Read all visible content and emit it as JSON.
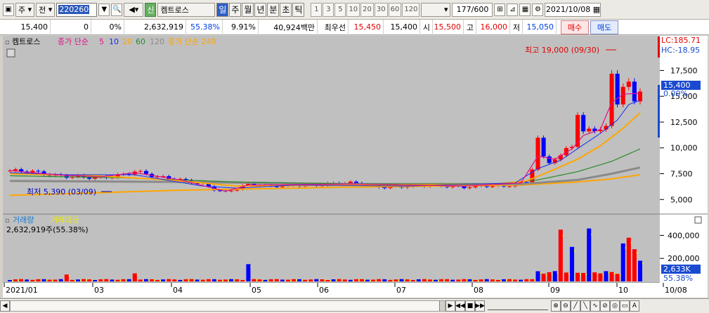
{
  "toolbar": {
    "market": "주",
    "period_selector": "전",
    "stock_code": "220260",
    "stock_name": "켐트로스",
    "credit_badge": "신",
    "periods": [
      "일",
      "주",
      "월",
      "년",
      "분",
      "초",
      "틱"
    ],
    "active_period": "일",
    "intervals": [
      "1",
      "3",
      "5",
      "10",
      "20",
      "30",
      "60",
      "120"
    ],
    "page_count": "177",
    "page_total": "/600",
    "date": "2021/10/08"
  },
  "quote": {
    "price": "15,400",
    "change": "0",
    "change_pct": "0%",
    "volume": "2,632,919",
    "volume_ratio": "55.38%",
    "turnover": "9.91%",
    "trade_value": "40,924백만",
    "best_bid_label": "최우선",
    "best_ask": "15,450",
    "best_bid": "15,400",
    "open_label": "시",
    "open": "15,500",
    "high_label": "고",
    "high": "16,000",
    "low_label": "저",
    "low": "15,050",
    "buy_label": "매수",
    "sell_label": "매도"
  },
  "price_panel": {
    "name": "켐트로스",
    "ma_label_1": "종가 단순",
    "ma_periods": [
      "5",
      "10",
      "20",
      "60",
      "120"
    ],
    "ma_label_2": "종가 단순 240",
    "colors": {
      "ma5": "#e0108a",
      "ma10": "#1a2cf0",
      "ma20": "#ffa500",
      "ma60": "#2a8a2a",
      "ma120": "#8a8a8a",
      "ma240": "#ffa500",
      "up": "#ff0000",
      "down": "#0000ff"
    },
    "high_note": "최고 19,000 (09/30)",
    "low_note": "최저 5,390 (03/09)",
    "lc": "LC:185.71",
    "hc": "HC:-18.95",
    "current_tag": "15,400",
    "current_pct": "0.00%",
    "y_ticks": [
      "17,500",
      "15,000",
      "12,500",
      "10,000",
      "7,500",
      "5,000"
    ]
  },
  "volume_panel": {
    "title_1": "거래량",
    "title_2": "거래대금",
    "value": "2,632,919주(55.38%)",
    "y_ticks": [
      "400,000",
      "200,000"
    ],
    "current_tag": "2,633K",
    "current_pct": "55.38%"
  },
  "x_axis": [
    "2021/01",
    "03",
    "04",
    "05",
    "06",
    "07",
    "08",
    "09",
    "10",
    "10/08"
  ],
  "chart_data": {
    "type": "candlestick",
    "ylim": [
      4000,
      19500
    ],
    "price_path": [
      [
        0,
        7800
      ],
      [
        4,
        7700
      ],
      [
        8,
        7300
      ],
      [
        12,
        7200
      ],
      [
        16,
        7100
      ],
      [
        20,
        7400
      ],
      [
        22,
        7750
      ],
      [
        26,
        7200
      ],
      [
        30,
        6900
      ],
      [
        34,
        6500
      ],
      [
        36,
        6000
      ],
      [
        38,
        5700
      ],
      [
        40,
        6100
      ],
      [
        42,
        6500
      ],
      [
        46,
        6300
      ],
      [
        50,
        6400
      ],
      [
        54,
        6400
      ],
      [
        58,
        6600
      ],
      [
        62,
        6600
      ],
      [
        64,
        6300
      ],
      [
        66,
        6200
      ],
      [
        70,
        6300
      ],
      [
        72,
        6400
      ],
      [
        76,
        6350
      ],
      [
        80,
        6200
      ],
      [
        84,
        6350
      ],
      [
        87,
        6300
      ],
      [
        89,
        6500
      ],
      [
        91,
        6700
      ],
      [
        92,
        8000
      ],
      [
        93,
        10800
      ],
      [
        94,
        9100
      ],
      [
        95,
        8700
      ],
      [
        96,
        8900
      ],
      [
        97,
        9100
      ],
      [
        98,
        10000
      ],
      [
        99,
        10300
      ],
      [
        100,
        13100
      ],
      [
        101,
        11400
      ],
      [
        102,
        12000
      ],
      [
        103,
        11800
      ],
      [
        104,
        11600
      ],
      [
        105,
        12000
      ],
      [
        106,
        17500
      ],
      [
        107,
        14300
      ],
      [
        108,
        15600
      ],
      [
        109,
        16400
      ],
      [
        110,
        14800
      ],
      [
        111,
        15400
      ]
    ],
    "ma5_path": [
      [
        0,
        7800
      ],
      [
        8,
        7400
      ],
      [
        16,
        7200
      ],
      [
        22,
        7600
      ],
      [
        30,
        6900
      ],
      [
        38,
        5800
      ],
      [
        42,
        6400
      ],
      [
        60,
        6500
      ],
      [
        80,
        6300
      ],
      [
        90,
        6600
      ],
      [
        93,
        9200
      ],
      [
        96,
        8900
      ],
      [
        99,
        9900
      ],
      [
        101,
        11200
      ],
      [
        104,
        11800
      ],
      [
        106,
        14400
      ],
      [
        108,
        15200
      ],
      [
        111,
        15300
      ]
    ],
    "ma10_path": [
      [
        0,
        7600
      ],
      [
        10,
        7400
      ],
      [
        22,
        7400
      ],
      [
        34,
        6300
      ],
      [
        40,
        6100
      ],
      [
        50,
        6400
      ],
      [
        70,
        6300
      ],
      [
        89,
        6600
      ],
      [
        93,
        8000
      ],
      [
        97,
        8800
      ],
      [
        101,
        10300
      ],
      [
        104,
        11400
      ],
      [
        107,
        12700
      ],
      [
        109,
        14200
      ],
      [
        111,
        14600
      ]
    ],
    "ma20_path": [
      [
        0,
        7500
      ],
      [
        15,
        7300
      ],
      [
        28,
        6900
      ],
      [
        40,
        6300
      ],
      [
        60,
        6400
      ],
      [
        85,
        6450
      ],
      [
        91,
        6800
      ],
      [
        95,
        7700
      ],
      [
        100,
        8900
      ],
      [
        104,
        10200
      ],
      [
        108,
        11900
      ],
      [
        111,
        13400
      ]
    ],
    "ma60_path": [
      [
        0,
        7300
      ],
      [
        20,
        7100
      ],
      [
        40,
        6700
      ],
      [
        60,
        6500
      ],
      [
        85,
        6500
      ],
      [
        93,
        6900
      ],
      [
        100,
        7700
      ],
      [
        106,
        8700
      ],
      [
        111,
        9900
      ]
    ],
    "ma120_path": [
      [
        0,
        6800
      ],
      [
        30,
        6700
      ],
      [
        60,
        6500
      ],
      [
        90,
        6500
      ],
      [
        100,
        6900
      ],
      [
        106,
        7500
      ],
      [
        111,
        8100
      ]
    ],
    "ma240_path": [
      [
        0,
        5400
      ],
      [
        30,
        5900
      ],
      [
        60,
        6200
      ],
      [
        90,
        6400
      ],
      [
        100,
        6700
      ],
      [
        106,
        7000
      ],
      [
        111,
        7400
      ]
    ],
    "volume_spikes": [
      [
        10,
        60000
      ],
      [
        22,
        70000
      ],
      [
        42,
        150000
      ],
      [
        97,
        450000
      ],
      [
        99,
        300000
      ],
      [
        102,
        460000
      ],
      [
        108,
        330000
      ],
      [
        109,
        380000
      ],
      [
        110,
        280000
      ],
      [
        111,
        180000
      ],
      [
        115,
        330000
      ],
      [
        118,
        450000
      ],
      [
        120,
        300000
      ],
      [
        121,
        200000
      ],
      [
        122,
        120000
      ]
    ],
    "volume_ylim": [
      0,
      500000
    ]
  }
}
